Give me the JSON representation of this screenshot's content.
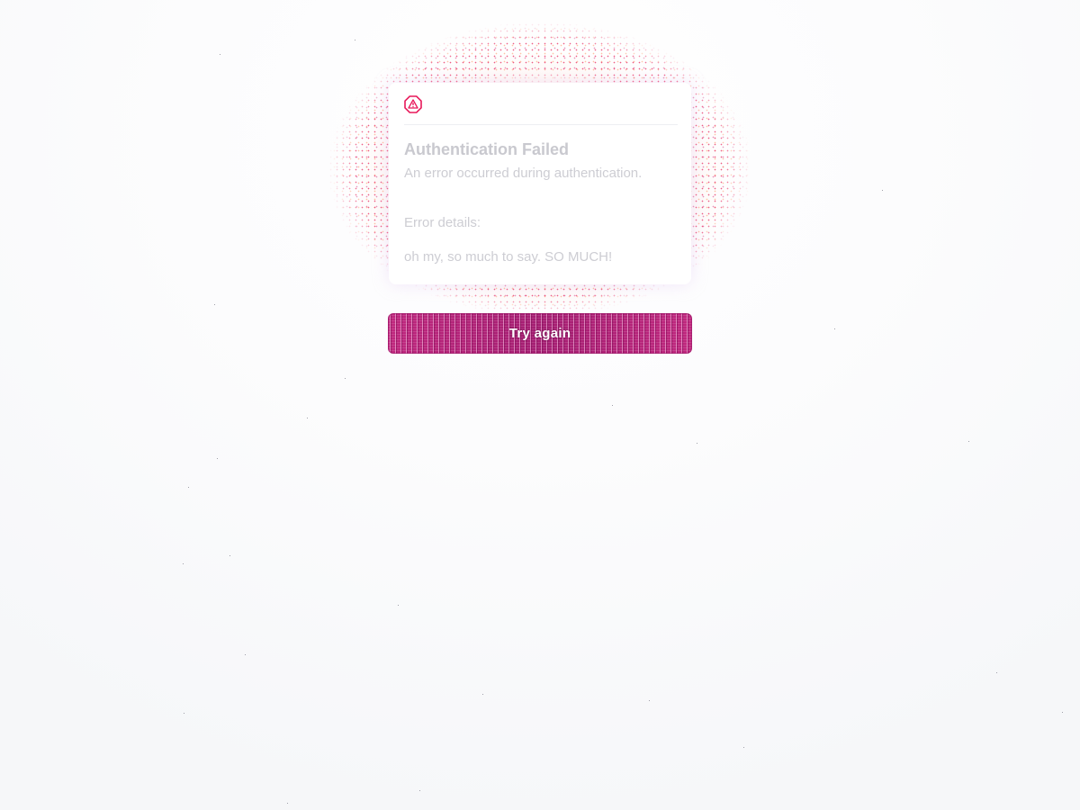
{
  "error_card": {
    "title": "Authentication Failed",
    "subtitle": "An error occurred during authentication.",
    "details_label": "Error details:",
    "details_text": "oh my, so much to say. SO MUCH!",
    "icon": "alert-octagon-icon"
  },
  "actions": {
    "retry_label": "Try again"
  },
  "colors": {
    "accent": "#e8185a",
    "button": "#b0247a",
    "muted_text": "#cdcdd3",
    "background": "#f8f9fa"
  }
}
